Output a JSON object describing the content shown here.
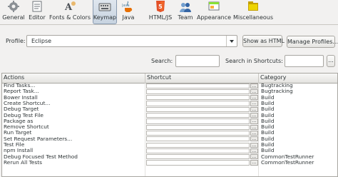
{
  "toolbar": {
    "items": [
      {
        "label": "General",
        "icon": "general-icon"
      },
      {
        "label": "Editor",
        "icon": "editor-icon"
      },
      {
        "label": "Fonts & Colors",
        "icon": "fonts-colors-icon"
      },
      {
        "label": "Keymap",
        "icon": "keymap-icon",
        "selected": true
      },
      {
        "label": "Java",
        "icon": "java-icon"
      },
      {
        "label": "HTML/JS",
        "icon": "html5-icon"
      },
      {
        "label": "Team",
        "icon": "team-icon"
      },
      {
        "label": "Appearance",
        "icon": "appearance-icon"
      },
      {
        "label": "Miscellaneous",
        "icon": "miscellaneous-icon"
      }
    ]
  },
  "profile": {
    "label": "Profile:",
    "value": "Eclipse",
    "show_html_label": "Show as HTML",
    "manage_label": "Manage Profiles..."
  },
  "search": {
    "label": "Search:",
    "shortcuts_label": "Search in Shortcuts:",
    "value": "",
    "shortcut_value": "",
    "ellipsis_label": "..."
  },
  "table": {
    "columns": [
      "Actions",
      "Shortcut",
      "Category"
    ],
    "browse_label": "...",
    "rows": [
      {
        "action": "Find Tasks...",
        "shortcut": "",
        "category": "Bugtracking"
      },
      {
        "action": "Report Task...",
        "shortcut": "",
        "category": "Bugtracking"
      },
      {
        "action": "Bower Install",
        "shortcut": "",
        "category": "Build"
      },
      {
        "action": "Create Shortcut...",
        "shortcut": "",
        "category": "Build"
      },
      {
        "action": "Debug Target",
        "shortcut": "",
        "category": "Build"
      },
      {
        "action": "Debug Test File",
        "shortcut": "",
        "category": "Build"
      },
      {
        "action": "Package as",
        "shortcut": "",
        "category": "Build"
      },
      {
        "action": "Remove Shortcut",
        "shortcut": "",
        "category": "Build"
      },
      {
        "action": "Run Target",
        "shortcut": "",
        "category": "Build"
      },
      {
        "action": "Set Request Parameters...",
        "shortcut": "",
        "category": "Build"
      },
      {
        "action": "Test File",
        "shortcut": "",
        "category": "Build"
      },
      {
        "action": "npm Install",
        "shortcut": "",
        "category": "Build"
      },
      {
        "action": "Debug Focused Test Method",
        "shortcut": "",
        "category": "CommonTestRunner"
      },
      {
        "action": "Rerun All Tests",
        "shortcut": "",
        "category": "CommonTestRunner"
      }
    ]
  },
  "colors": {
    "selected_tab": "#c7d3e0",
    "java_orange": "#e76f00",
    "html5_orange": "#e34f26",
    "window_bg": "#f2f1f0"
  }
}
